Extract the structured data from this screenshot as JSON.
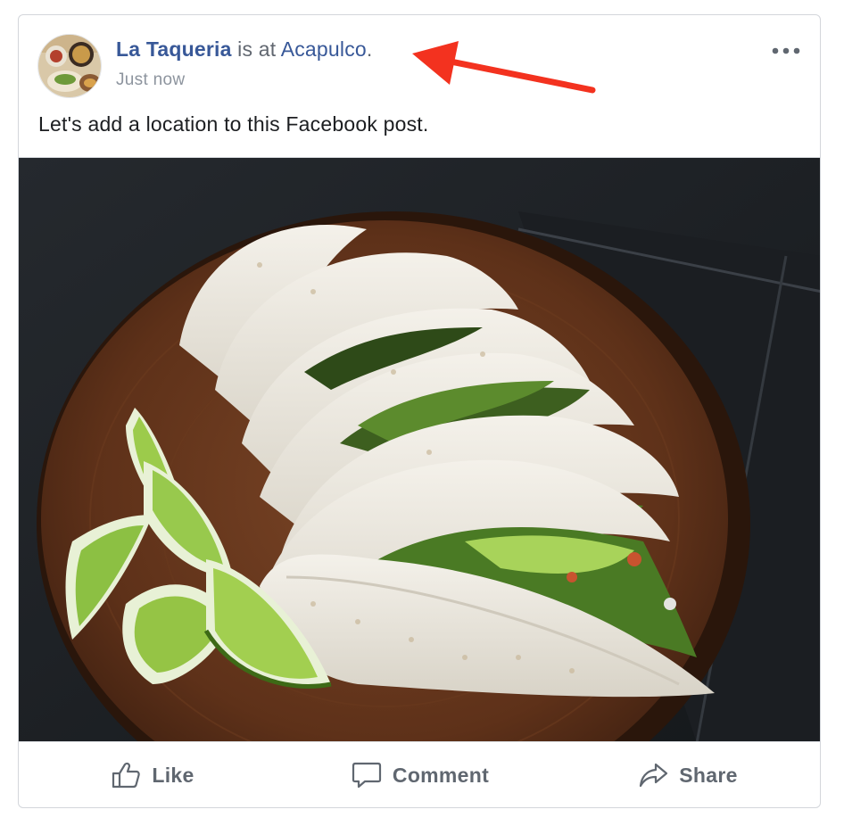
{
  "post": {
    "author": "La Taqueria",
    "connector": " is at ",
    "location": "Acapulco",
    "period": ".",
    "timestamp": "Just now",
    "text": "Let's add a location to this Facebook post."
  },
  "actions": {
    "like": "Like",
    "comment": "Comment",
    "share": "Share"
  },
  "icons": {
    "more": "more-options-icon",
    "like": "thumbs-up-icon",
    "comment": "speech-bubble-icon",
    "share": "share-arrow-icon"
  },
  "colors": {
    "link": "#385898",
    "annotation_arrow": "#f3321f",
    "action_text": "#606770"
  }
}
